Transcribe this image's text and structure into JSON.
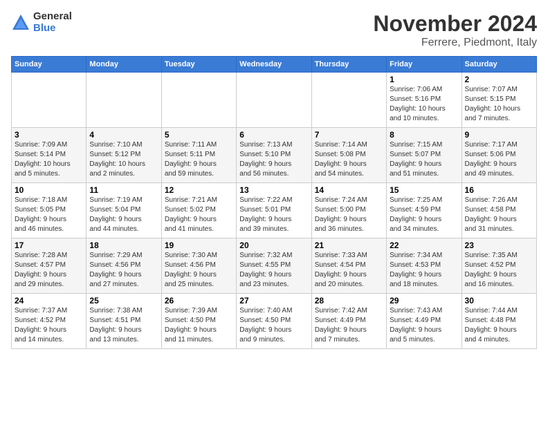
{
  "logo": {
    "general": "General",
    "blue": "Blue"
  },
  "title": "November 2024",
  "location": "Ferrere, Piedmont, Italy",
  "days_of_week": [
    "Sunday",
    "Monday",
    "Tuesday",
    "Wednesday",
    "Thursday",
    "Friday",
    "Saturday"
  ],
  "weeks": [
    [
      {
        "day": "",
        "info": ""
      },
      {
        "day": "",
        "info": ""
      },
      {
        "day": "",
        "info": ""
      },
      {
        "day": "",
        "info": ""
      },
      {
        "day": "",
        "info": ""
      },
      {
        "day": "1",
        "info": "Sunrise: 7:06 AM\nSunset: 5:16 PM\nDaylight: 10 hours\nand 10 minutes."
      },
      {
        "day": "2",
        "info": "Sunrise: 7:07 AM\nSunset: 5:15 PM\nDaylight: 10 hours\nand 7 minutes."
      }
    ],
    [
      {
        "day": "3",
        "info": "Sunrise: 7:09 AM\nSunset: 5:14 PM\nDaylight: 10 hours\nand 5 minutes."
      },
      {
        "day": "4",
        "info": "Sunrise: 7:10 AM\nSunset: 5:12 PM\nDaylight: 10 hours\nand 2 minutes."
      },
      {
        "day": "5",
        "info": "Sunrise: 7:11 AM\nSunset: 5:11 PM\nDaylight: 9 hours\nand 59 minutes."
      },
      {
        "day": "6",
        "info": "Sunrise: 7:13 AM\nSunset: 5:10 PM\nDaylight: 9 hours\nand 56 minutes."
      },
      {
        "day": "7",
        "info": "Sunrise: 7:14 AM\nSunset: 5:08 PM\nDaylight: 9 hours\nand 54 minutes."
      },
      {
        "day": "8",
        "info": "Sunrise: 7:15 AM\nSunset: 5:07 PM\nDaylight: 9 hours\nand 51 minutes."
      },
      {
        "day": "9",
        "info": "Sunrise: 7:17 AM\nSunset: 5:06 PM\nDaylight: 9 hours\nand 49 minutes."
      }
    ],
    [
      {
        "day": "10",
        "info": "Sunrise: 7:18 AM\nSunset: 5:05 PM\nDaylight: 9 hours\nand 46 minutes."
      },
      {
        "day": "11",
        "info": "Sunrise: 7:19 AM\nSunset: 5:04 PM\nDaylight: 9 hours\nand 44 minutes."
      },
      {
        "day": "12",
        "info": "Sunrise: 7:21 AM\nSunset: 5:02 PM\nDaylight: 9 hours\nand 41 minutes."
      },
      {
        "day": "13",
        "info": "Sunrise: 7:22 AM\nSunset: 5:01 PM\nDaylight: 9 hours\nand 39 minutes."
      },
      {
        "day": "14",
        "info": "Sunrise: 7:24 AM\nSunset: 5:00 PM\nDaylight: 9 hours\nand 36 minutes."
      },
      {
        "day": "15",
        "info": "Sunrise: 7:25 AM\nSunset: 4:59 PM\nDaylight: 9 hours\nand 34 minutes."
      },
      {
        "day": "16",
        "info": "Sunrise: 7:26 AM\nSunset: 4:58 PM\nDaylight: 9 hours\nand 31 minutes."
      }
    ],
    [
      {
        "day": "17",
        "info": "Sunrise: 7:28 AM\nSunset: 4:57 PM\nDaylight: 9 hours\nand 29 minutes."
      },
      {
        "day": "18",
        "info": "Sunrise: 7:29 AM\nSunset: 4:56 PM\nDaylight: 9 hours\nand 27 minutes."
      },
      {
        "day": "19",
        "info": "Sunrise: 7:30 AM\nSunset: 4:56 PM\nDaylight: 9 hours\nand 25 minutes."
      },
      {
        "day": "20",
        "info": "Sunrise: 7:32 AM\nSunset: 4:55 PM\nDaylight: 9 hours\nand 23 minutes."
      },
      {
        "day": "21",
        "info": "Sunrise: 7:33 AM\nSunset: 4:54 PM\nDaylight: 9 hours\nand 20 minutes."
      },
      {
        "day": "22",
        "info": "Sunrise: 7:34 AM\nSunset: 4:53 PM\nDaylight: 9 hours\nand 18 minutes."
      },
      {
        "day": "23",
        "info": "Sunrise: 7:35 AM\nSunset: 4:52 PM\nDaylight: 9 hours\nand 16 minutes."
      }
    ],
    [
      {
        "day": "24",
        "info": "Sunrise: 7:37 AM\nSunset: 4:52 PM\nDaylight: 9 hours\nand 14 minutes."
      },
      {
        "day": "25",
        "info": "Sunrise: 7:38 AM\nSunset: 4:51 PM\nDaylight: 9 hours\nand 13 minutes."
      },
      {
        "day": "26",
        "info": "Sunrise: 7:39 AM\nSunset: 4:50 PM\nDaylight: 9 hours\nand 11 minutes."
      },
      {
        "day": "27",
        "info": "Sunrise: 7:40 AM\nSunset: 4:50 PM\nDaylight: 9 hours\nand 9 minutes."
      },
      {
        "day": "28",
        "info": "Sunrise: 7:42 AM\nSunset: 4:49 PM\nDaylight: 9 hours\nand 7 minutes."
      },
      {
        "day": "29",
        "info": "Sunrise: 7:43 AM\nSunset: 4:49 PM\nDaylight: 9 hours\nand 5 minutes."
      },
      {
        "day": "30",
        "info": "Sunrise: 7:44 AM\nSunset: 4:48 PM\nDaylight: 9 hours\nand 4 minutes."
      }
    ]
  ],
  "accent_color": "#3a7bd5"
}
